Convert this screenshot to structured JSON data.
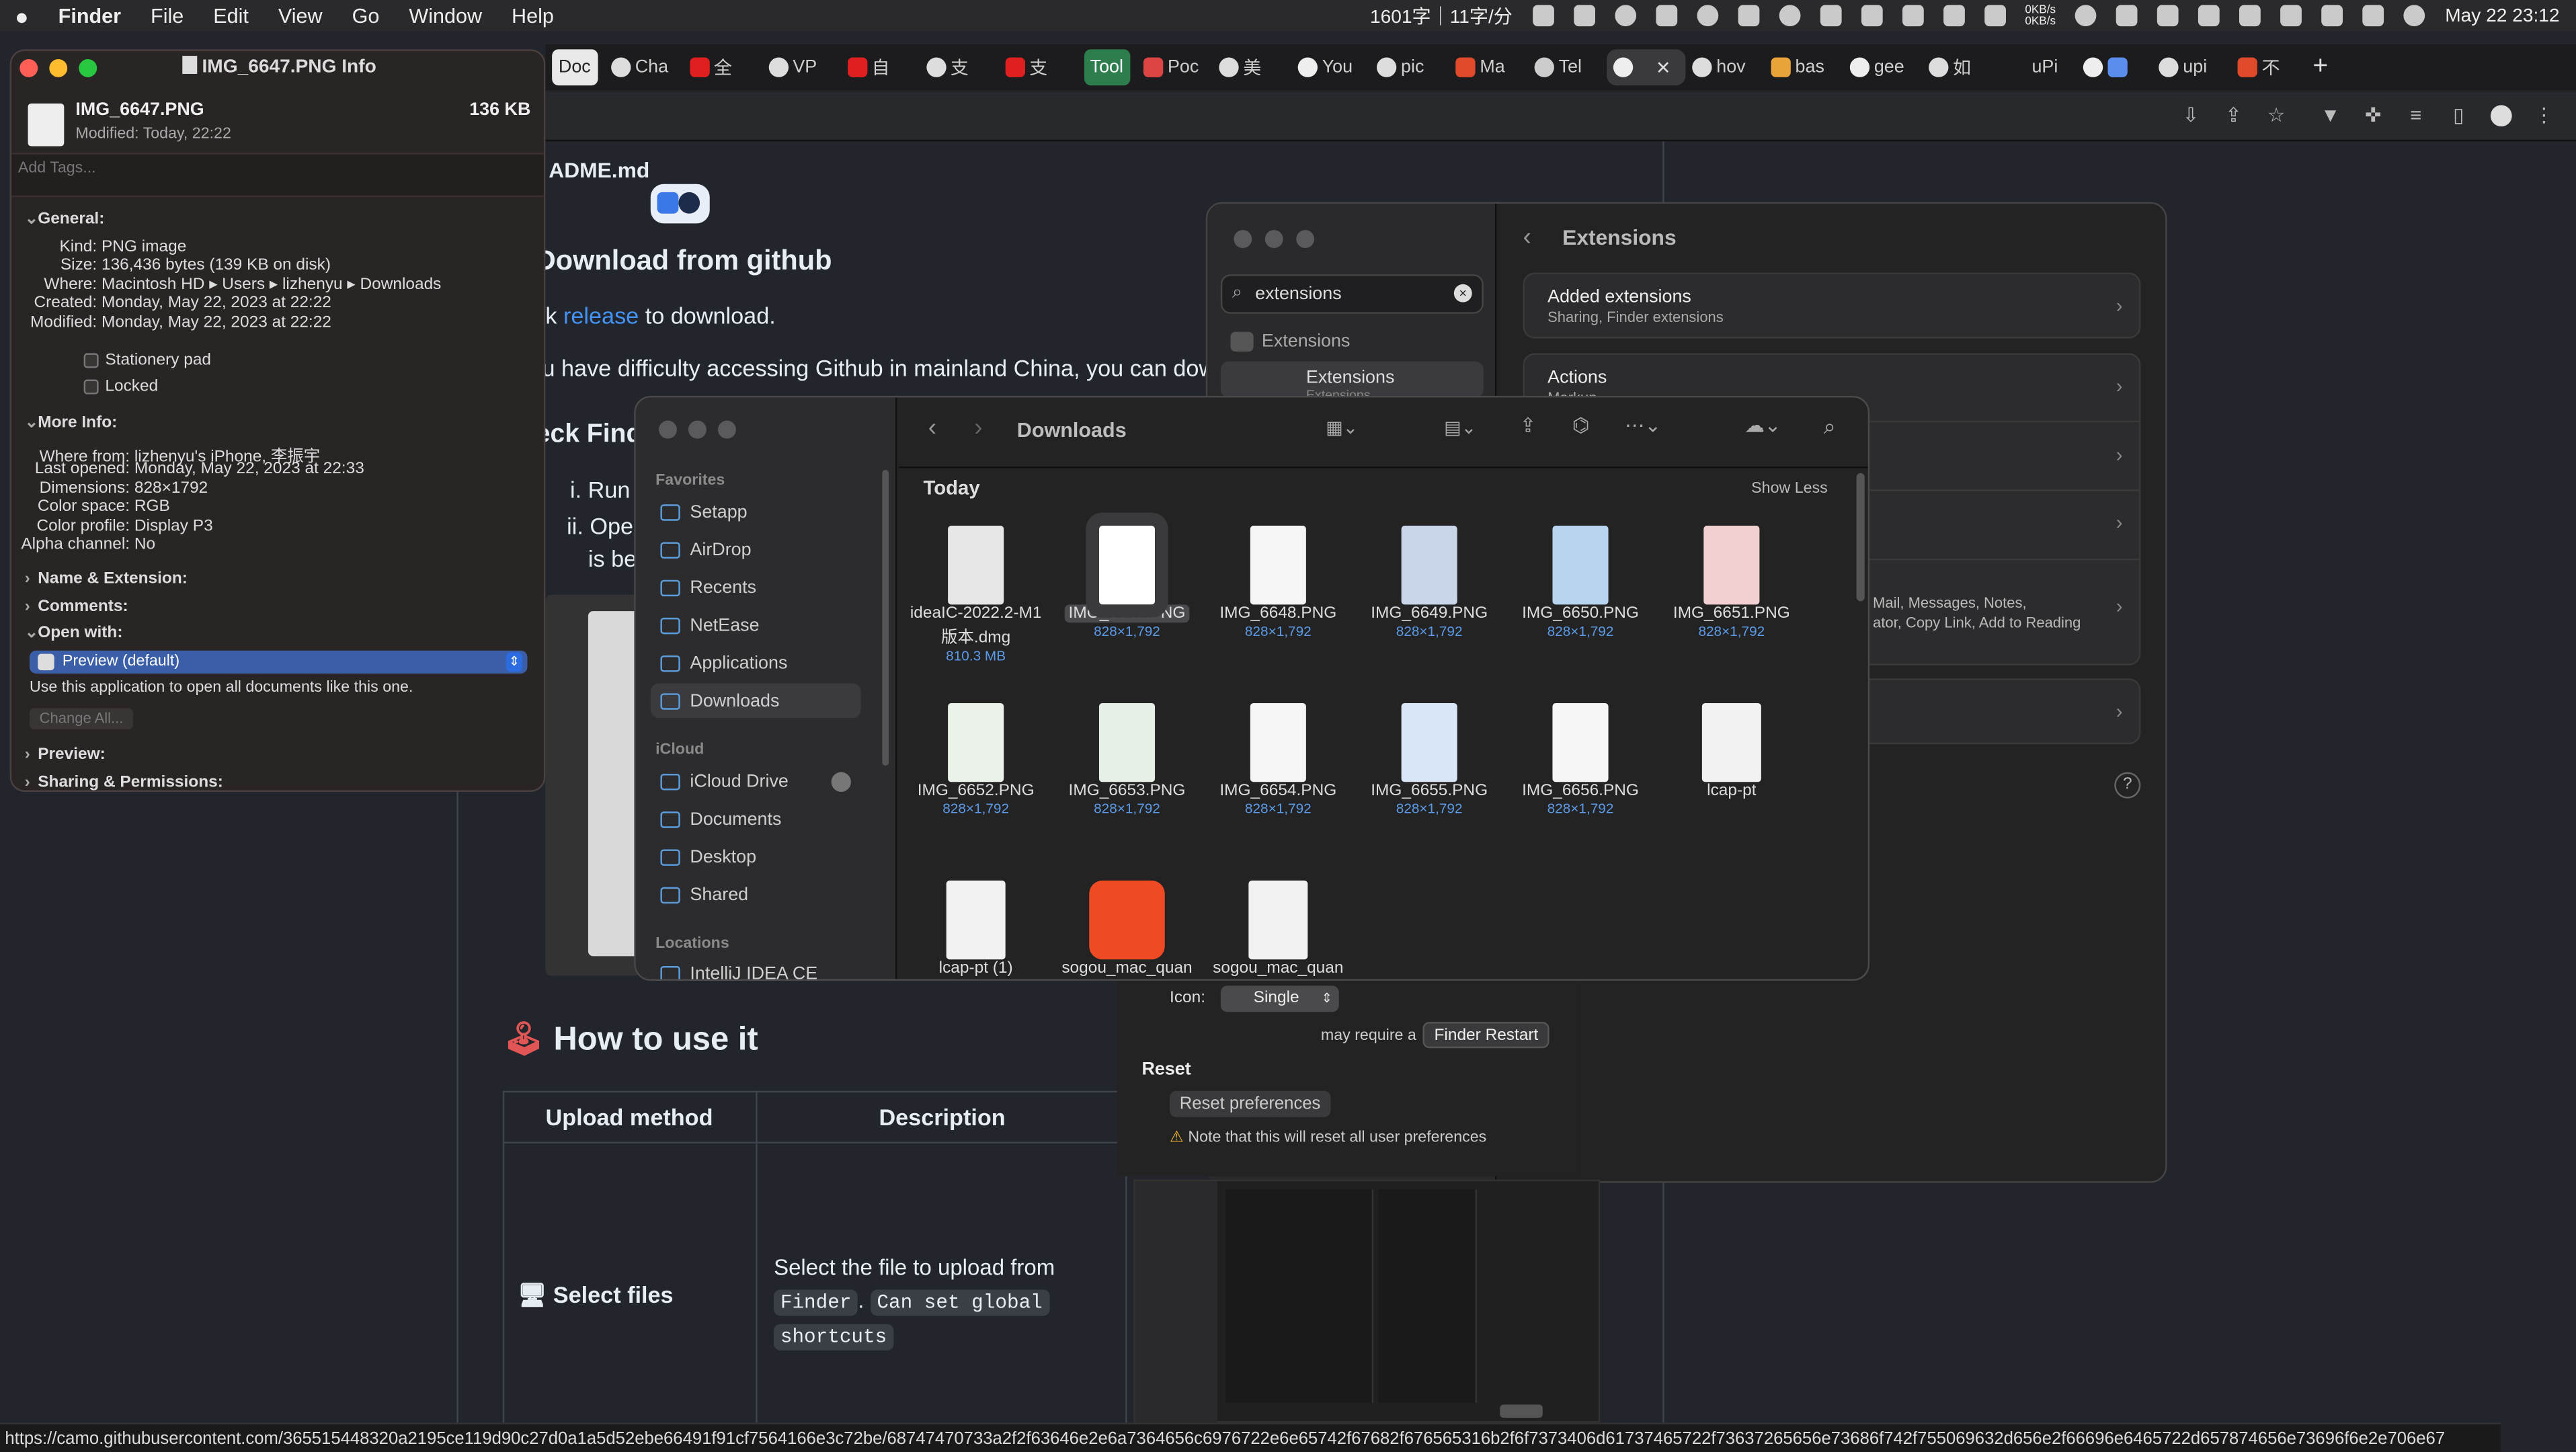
{
  "menubar": {
    "apple": "",
    "items": [
      "Finder",
      "File",
      "Edit",
      "View",
      "Go",
      "Window",
      "Help"
    ],
    "counter": "1601字｜11字/分",
    "net": "0KB/s",
    "net2": "0KB/s",
    "datetime": "May 22  23:12"
  },
  "browser": {
    "tabs": [
      "Doc",
      "Cha",
      "全",
      "VP",
      "自",
      "支",
      "支",
      "Tool",
      "Poc",
      "美",
      "You",
      "pic",
      "Ma",
      "Tel",
      "",
      "hov",
      "bas",
      "gee",
      "如",
      "uPi",
      "",
      "upi",
      "不"
    ],
    "new_tab": "+"
  },
  "github": {
    "readme": "ADME.md",
    "h_download": "Download from github",
    "p1_prefix": "k ",
    "p1_link": "release",
    "p1_suffix": " to download.",
    "p2": "u have difficulty accessing Github in mainland China, you can dow",
    "h_check": "eck Find",
    "li1": "i. Run",
    "li2": "ii. Ope",
    "li3": "is be",
    "h_howto": "How to use it",
    "th1": "Upload method",
    "th2": "Description",
    "td1": "Select files",
    "td2_a": "Select the file to upload from ",
    "td2_code1": "Finder",
    "td2_b": ". ",
    "td2_code2": "Can set global",
    "td2_code3": "shortcuts"
  },
  "info": {
    "title": "IMG_6647.PNG Info",
    "filename": "IMG_6647.PNG",
    "filesize": "136 KB",
    "modified_short": "Modified: Today, 22:22",
    "tags_placeholder": "Add Tags...",
    "general": "General:",
    "kind_l": "Kind:",
    "kind_v": "PNG image",
    "size_l": "Size:",
    "size_v": "136,436 bytes (139 KB on disk)",
    "where_l": "Where:",
    "where_v": "Macintosh HD ▸ Users ▸ lizhenyu ▸ Downloads",
    "created_l": "Created:",
    "created_v": "Monday, May 22, 2023 at 22:22",
    "modified_l": "Modified:",
    "modified_v": "Monday, May 22, 2023 at 22:22",
    "stationery": "Stationery pad",
    "locked": "Locked",
    "more_info": "More Info:",
    "wherefrom_l": "Where from:",
    "wherefrom_v": "lizhenyu's iPhone, 李振宇",
    "lastopened_l": "Last opened:",
    "lastopened_v": "Monday, May 22, 2023 at 22:33",
    "dims_l": "Dimensions:",
    "dims_v": "828×1792",
    "colorspace_l": "Color space:",
    "colorspace_v": "RGB",
    "profile_l": "Color profile:",
    "profile_v": "Display P3",
    "alpha_l": "Alpha channel:",
    "alpha_v": "No",
    "name_ext": "Name & Extension:",
    "comments": "Comments:",
    "open_with": "Open with:",
    "app": "Preview (default)",
    "open_desc": "Use this application to open all documents like this one.",
    "change_all": "Change All...",
    "preview": "Preview:",
    "sharing": "Sharing & Permissions:"
  },
  "finder": {
    "title": "Downloads",
    "section": "Today",
    "show_less": "Show Less",
    "sidebar": {
      "favorites": "Favorites",
      "items": [
        "Setapp",
        "AirDrop",
        "Recents",
        "NetEase",
        "Applications",
        "Downloads"
      ],
      "icloud": "iCloud",
      "icloud_items": [
        "iCloud Drive",
        "Documents",
        "Desktop",
        "Shared"
      ],
      "locations": "Locations",
      "loc_items": [
        "IntelliJ IDEA CE"
      ]
    },
    "files": [
      {
        "name": "ideaIC-2022.2-M1 版本.dmg",
        "meta": "810.3 MB"
      },
      {
        "name": "IMG_6647.PNG",
        "meta": "828×1,792"
      },
      {
        "name": "IMG_6648.PNG",
        "meta": "828×1,792"
      },
      {
        "name": "IMG_6649.PNG",
        "meta": "828×1,792"
      },
      {
        "name": "IMG_6650.PNG",
        "meta": "828×1,792"
      },
      {
        "name": "IMG_6651.PNG",
        "meta": "828×1,792"
      },
      {
        "name": "IMG_6652.PNG",
        "meta": "828×1,792"
      },
      {
        "name": "IMG_6653.PNG",
        "meta": "828×1,792"
      },
      {
        "name": "IMG_6654.PNG",
        "meta": "828×1,792"
      },
      {
        "name": "IMG_6655.PNG",
        "meta": "828×1,792"
      },
      {
        "name": "IMG_6656.PNG",
        "meta": "828×1,792"
      },
      {
        "name": "lcap-pt",
        "meta": ""
      },
      {
        "name": "lcap-pt (1)",
        "meta": ""
      },
      {
        "name": "sogou_mac_quan",
        "meta": ""
      },
      {
        "name": "sogou_mac_quan",
        "meta": ""
      }
    ]
  },
  "extensions": {
    "search_value": "extensions",
    "side_header": "Extensions",
    "side_selected": "Extensions",
    "side_sub": "Extensions",
    "title": "Extensions",
    "added_title": "Added extensions",
    "added_sub": "Sharing, Finder extensions",
    "actions_title": "Actions",
    "actions_sub": "Markup",
    "share_sub_line1": "Mail, Messages, Notes,",
    "share_sub_line2": "ator, Copy Link, Add to Reading",
    "help": "?"
  },
  "settings_panel": {
    "icon_label": "Icon:",
    "icon_value": "Single",
    "restart_hint": "may require a",
    "restart_button": "Finder Restart",
    "reset_header": "Reset",
    "reset_button": "Reset preferences",
    "reset_note": "Note that this will reset all user preferences"
  },
  "status_url": "https://camo.githubusercontent.com/365515448320a2195ce119d90c27d0a1a5d52ebe66491f91cf7564166e3c72be/68747470733a2f2f63646e2e6a7364656c6976722e6e65742f67682f676565316b2f6f7373406d61737465722f73637265656e73686f742f755069632d656e2f66696e6465722d657874656e73696f6e2e706e67"
}
